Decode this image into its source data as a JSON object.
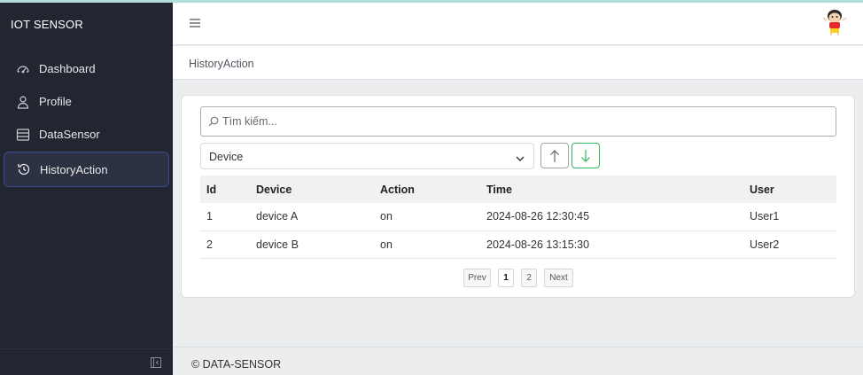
{
  "app": {
    "brand": "IOT SENSOR"
  },
  "sidebar": {
    "items": [
      {
        "label": "Dashboard",
        "icon": "speedometer-icon",
        "active": false
      },
      {
        "label": "Profile",
        "icon": "user-icon",
        "active": false
      },
      {
        "label": "DataSensor",
        "icon": "list-icon",
        "active": false
      },
      {
        "label": "HistoryAction",
        "icon": "history-icon",
        "active": true
      }
    ]
  },
  "header": {
    "menu_icon": "hamburger-icon",
    "avatar_icon": "avatar-icon"
  },
  "breadcrumb": {
    "current": "HistoryAction"
  },
  "filters": {
    "search_placeholder": "Tìm kiếm...",
    "search_value": "",
    "sort_field_selected": "Device",
    "sort_asc_icon": "arrow-up-icon",
    "sort_desc_icon": "arrow-down-icon"
  },
  "table": {
    "headers": {
      "id": "Id",
      "device": "Device",
      "action": "Action",
      "time": "Time",
      "user": "User"
    },
    "rows": [
      {
        "id": "1",
        "device": "device A",
        "action": "on",
        "time": "2024-08-26 12:30:45",
        "user": "User1"
      },
      {
        "id": "2",
        "device": "device B",
        "action": "on",
        "time": "2024-08-26 13:15:30",
        "user": "User2"
      }
    ]
  },
  "pagination": {
    "prev": "Prev",
    "pages": [
      "1",
      "2"
    ],
    "current": "1",
    "next": "Next"
  },
  "footer": {
    "text": "© DATA-SENSOR"
  },
  "colors": {
    "sidebar_bg": "#212631",
    "success": "#2eb85c",
    "active_border": "#3f4a7a"
  }
}
